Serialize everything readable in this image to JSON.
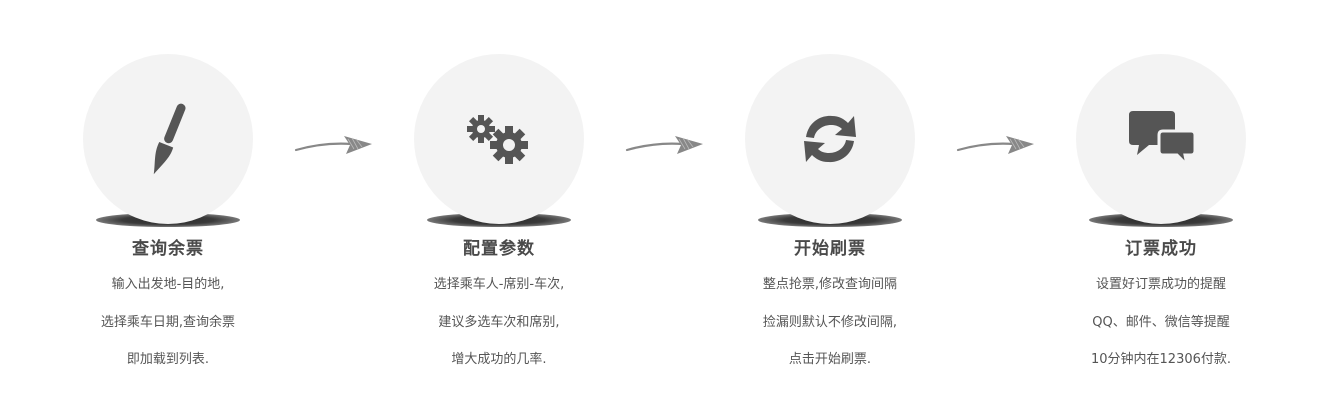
{
  "steps": [
    {
      "title": "查询余票",
      "icon": "brush-icon",
      "lines": [
        "输入出发地-目的地,",
        "选择乘车日期,查询余票",
        "即加载到列表."
      ]
    },
    {
      "title": "配置参数",
      "icon": "gears-icon",
      "lines": [
        "选择乘车人-席别-车次,",
        "建议多选车次和席别,",
        "增大成功的几率."
      ]
    },
    {
      "title": "开始刷票",
      "icon": "refresh-icon",
      "lines": [
        "整点抢票,修改查询间隔",
        "捡漏则默认不修改间隔,",
        "点击开始刷票."
      ]
    },
    {
      "title": "订票成功",
      "icon": "chat-bubbles-icon",
      "lines": [
        "设置好订票成功的提醒",
        "QQ、邮件、微信等提醒",
        "10分钟内在12306付款."
      ]
    }
  ],
  "colors": {
    "circle": "#f3f3f3",
    "icon": "#555555",
    "arrow": "#888888",
    "title": "#4a4a4a",
    "text": "#555555"
  }
}
